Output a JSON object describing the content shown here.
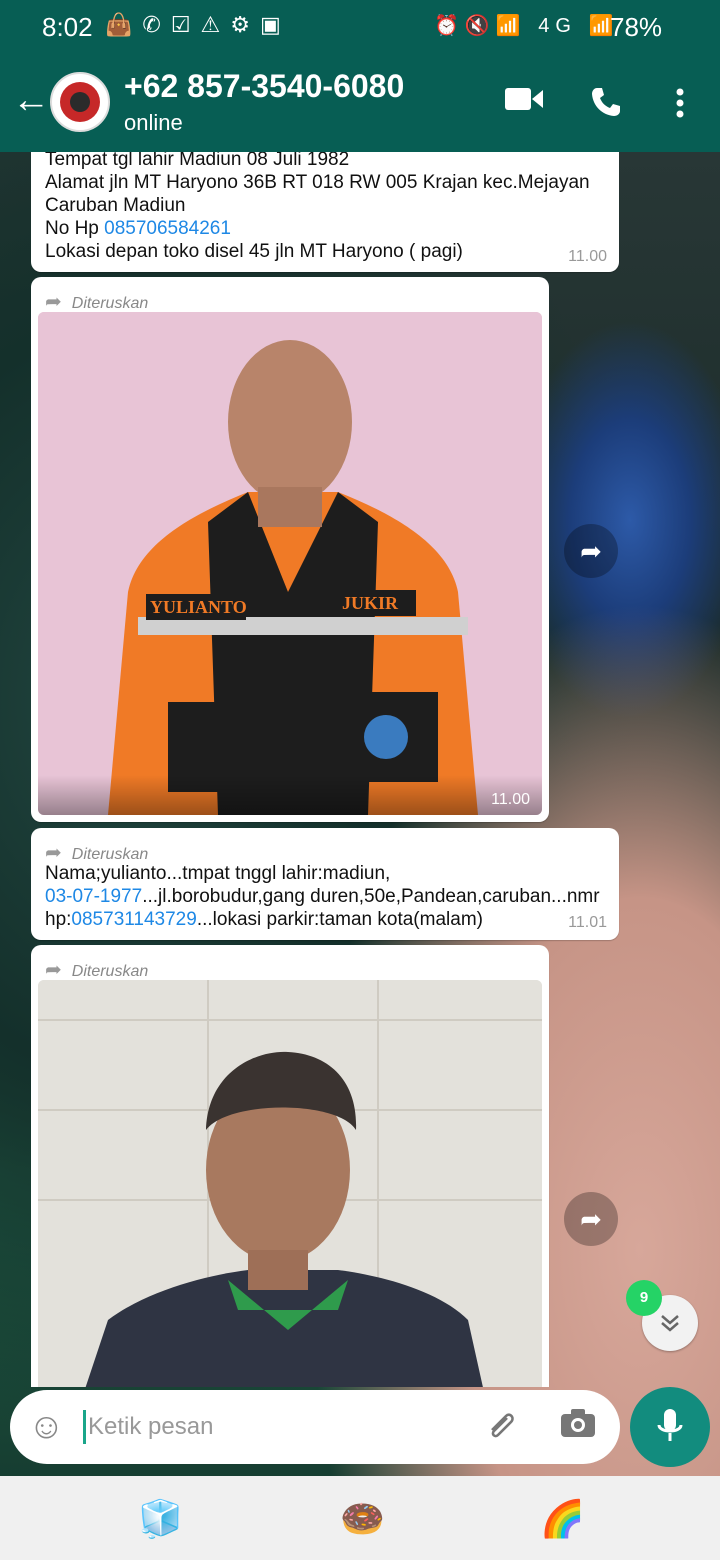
{
  "status_bar": {
    "time": "8:02",
    "battery": "78%",
    "left_icons": "👜✆☑⚠⚙▣",
    "right_icons": "⏰🔇📶 4G 📶"
  },
  "contact": {
    "title": "+62 857-3540-6080",
    "status": "online"
  },
  "icons": {
    "back": "arrow-left-icon",
    "video": "video-call-icon",
    "call": "phone-icon",
    "menu": "more-vertical-icon",
    "emoji": "emoji-icon",
    "attach": "paperclip-icon",
    "camera": "camera-icon",
    "mic": "mic-icon"
  },
  "messages": [
    {
      "type": "text",
      "lines": [
        "Tempat tgl lahir Madiun 08 Juli 1982",
        "Alamat jln MT Haryono 36B RT 018 RW 005  Krajan kec.Mejayan",
        "Caruban Madiun"
      ],
      "phone_prefix": "No Hp ",
      "phone": "085706584261",
      "location": "Lokasi depan toko disel 45 jln MT Haryono ( pagi)",
      "time": "11.00"
    },
    {
      "type": "image",
      "forwarded": "Diteruskan",
      "time": "11.00",
      "badges": [
        "YULIANTO",
        "JUKIR"
      ]
    },
    {
      "type": "text",
      "forwarded": "Diteruskan",
      "line1": "Nama;yulianto...tmpat tnggl lahir:madiun,",
      "date": "03-07-1977",
      "line2_rest": "...jl.borobudur,gang duren,50e,Pandean,caruban...nmr",
      "hp_prefix": "hp:",
      "hp": "085731143729",
      "hp_rest": "...lokasi parkir:taman kota(malam)",
      "time": "11.01"
    },
    {
      "type": "image",
      "forwarded": "Diteruskan"
    }
  ],
  "unread_count": "9",
  "input": {
    "placeholder": "Ketik pesan"
  },
  "stickers": [
    "🧊",
    "🍩",
    "🌈"
  ],
  "colors": {
    "header": "#075e54",
    "accent": "#128c7e",
    "link": "#1e88e5",
    "badge": "#25d366"
  }
}
